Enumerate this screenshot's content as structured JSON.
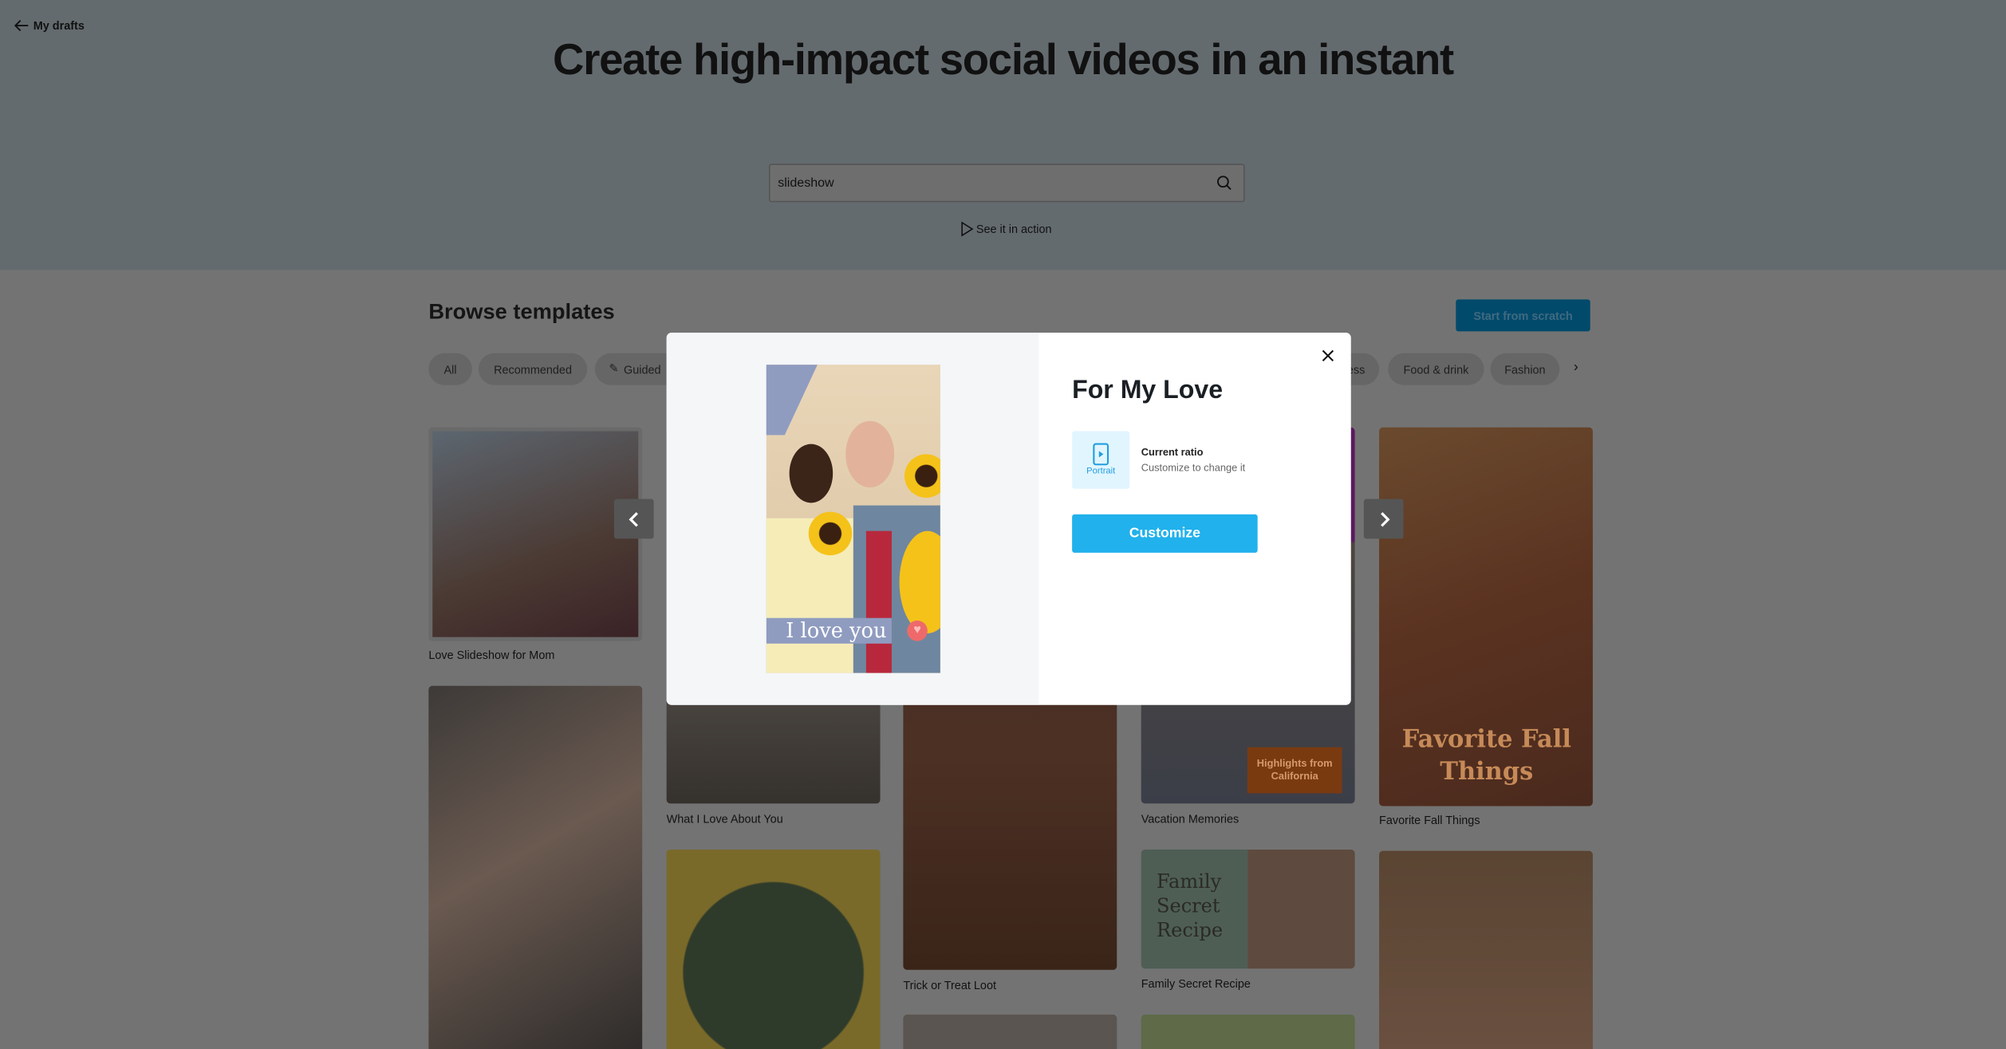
{
  "nav": {
    "back_label": "My drafts",
    "back_icon": "arrow-left-icon"
  },
  "hero": {
    "title": "Create high-impact social videos in an instant",
    "search": {
      "value": "slideshow",
      "icon": "search-icon"
    },
    "see_action": "See it in action"
  },
  "browse": {
    "title": "Browse templates",
    "start_button": "Start from scratch",
    "chips": [
      "All",
      "Recommended",
      "Guided",
      "ess",
      "Food & drink",
      "Fashion"
    ]
  },
  "templates": [
    {
      "label": "Love Slideshow for Mom"
    },
    {
      "label": "What I Love About You"
    },
    {
      "label": "Trick or Treat Loot"
    },
    {
      "label": "Vacation Memories",
      "overlay": "Highlights from California"
    },
    {
      "label": "Favorite Fall Things",
      "overlay": "Favorite Fall Things"
    },
    {
      "label": "Family Secret Recipe",
      "overlay": "Family Secret Recipe"
    }
  ],
  "modal": {
    "title": "For My Love",
    "ratio_name": "Portrait",
    "ratio_title": "Current ratio",
    "ratio_hint": "Customize to change it",
    "customize_button": "Customize",
    "preview_text": "I love you",
    "accent": "#21b1ec"
  }
}
